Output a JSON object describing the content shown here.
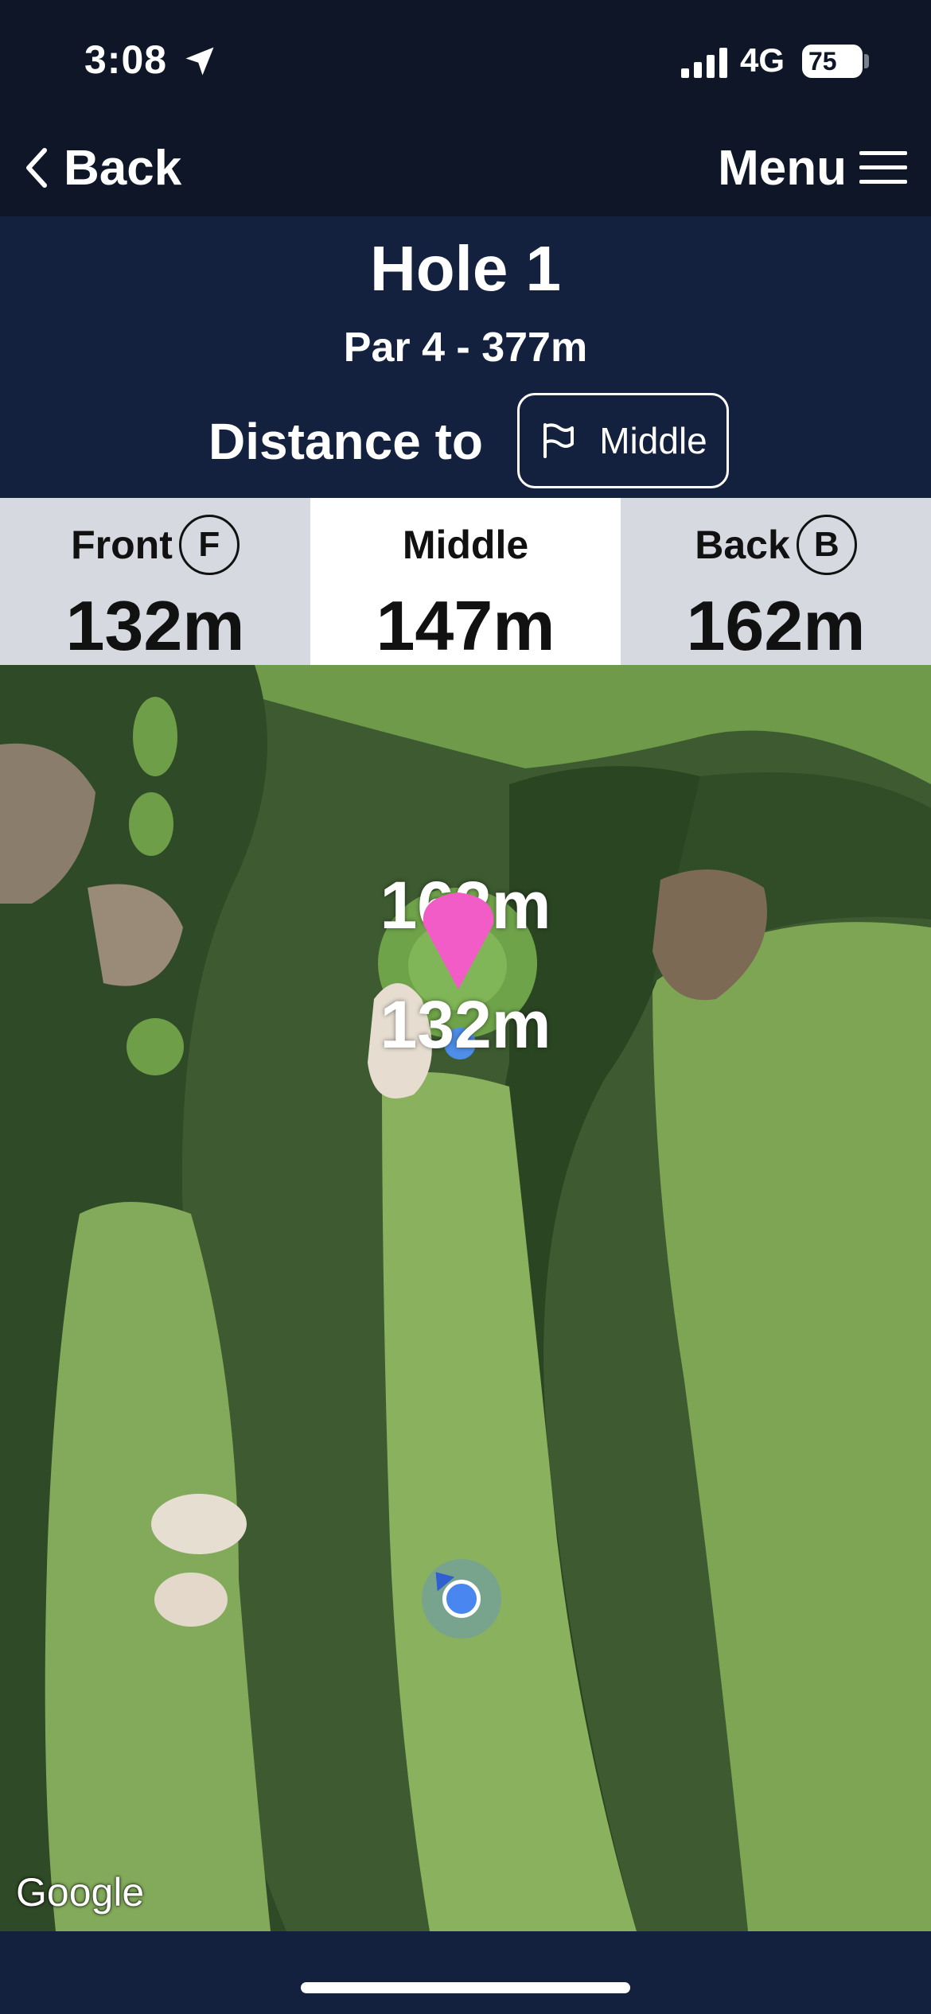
{
  "status_bar": {
    "time": "3:08",
    "network": "4G",
    "battery": "75"
  },
  "nav": {
    "back_label": "Back",
    "menu_label": "Menu"
  },
  "hole": {
    "title": "Hole 1",
    "subtitle": "Par 4 - 377m",
    "distance_to_label": "Distance to",
    "target_button_label": "Middle"
  },
  "distances": [
    {
      "label": "Front",
      "badge": "F",
      "value": "132m",
      "active": false
    },
    {
      "label": "Middle",
      "badge": "",
      "value": "147m",
      "active": true
    },
    {
      "label": "Back",
      "badge": "B",
      "value": "162m",
      "active": false
    }
  ],
  "map": {
    "back_distance_label": "162m",
    "front_distance_label": "132m",
    "attribution": "Google",
    "pin_color": "#f25cc6",
    "user_dot_color": "#4a86f0"
  },
  "icons": {
    "location": "location-arrow-icon",
    "signal": "signal-bars-icon",
    "back": "chevron-left-icon",
    "menu": "hamburger-icon",
    "flag": "flag-icon"
  },
  "colors": {
    "header_bg": "#0e1628",
    "panel_bg": "#13213e",
    "card_bg": "#d6d9df",
    "card_active_bg": "#ffffff"
  }
}
